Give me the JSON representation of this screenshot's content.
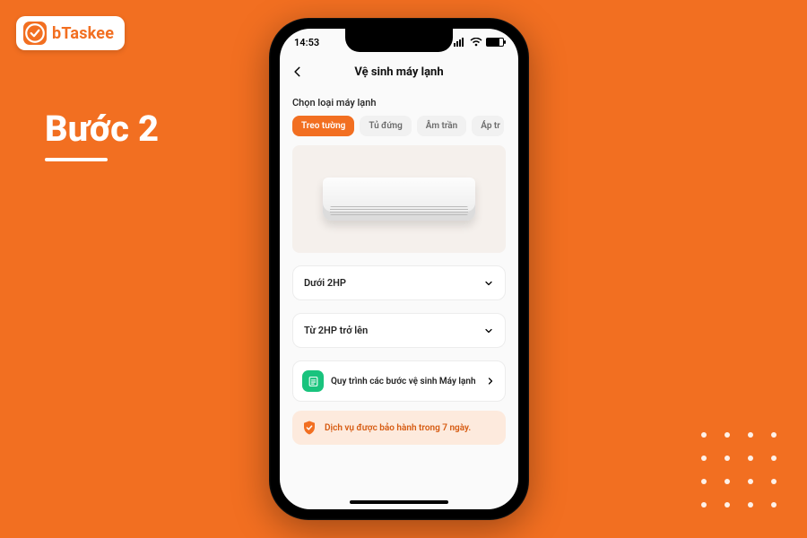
{
  "brand": {
    "name": "bTaskee"
  },
  "step": {
    "label": "Bước 2"
  },
  "statusbar": {
    "time": "14:53"
  },
  "header": {
    "title": "Vệ sinh máy lạnh"
  },
  "section": {
    "chooseType": "Chọn loại máy lạnh"
  },
  "tabs": {
    "items": [
      {
        "label": "Treo tường",
        "active": true
      },
      {
        "label": "Tủ đứng",
        "active": false
      },
      {
        "label": "Âm trần",
        "active": false
      },
      {
        "label": "Áp tr",
        "active": false
      }
    ]
  },
  "options": {
    "under2hp": "Dưới 2HP",
    "from2hp": "Từ 2HP trở lên"
  },
  "process": {
    "text": "Quy trình các bước vệ sinh Máy lạnh"
  },
  "warranty": {
    "text": "Dịch vụ được bảo hành trong 7 ngày."
  }
}
